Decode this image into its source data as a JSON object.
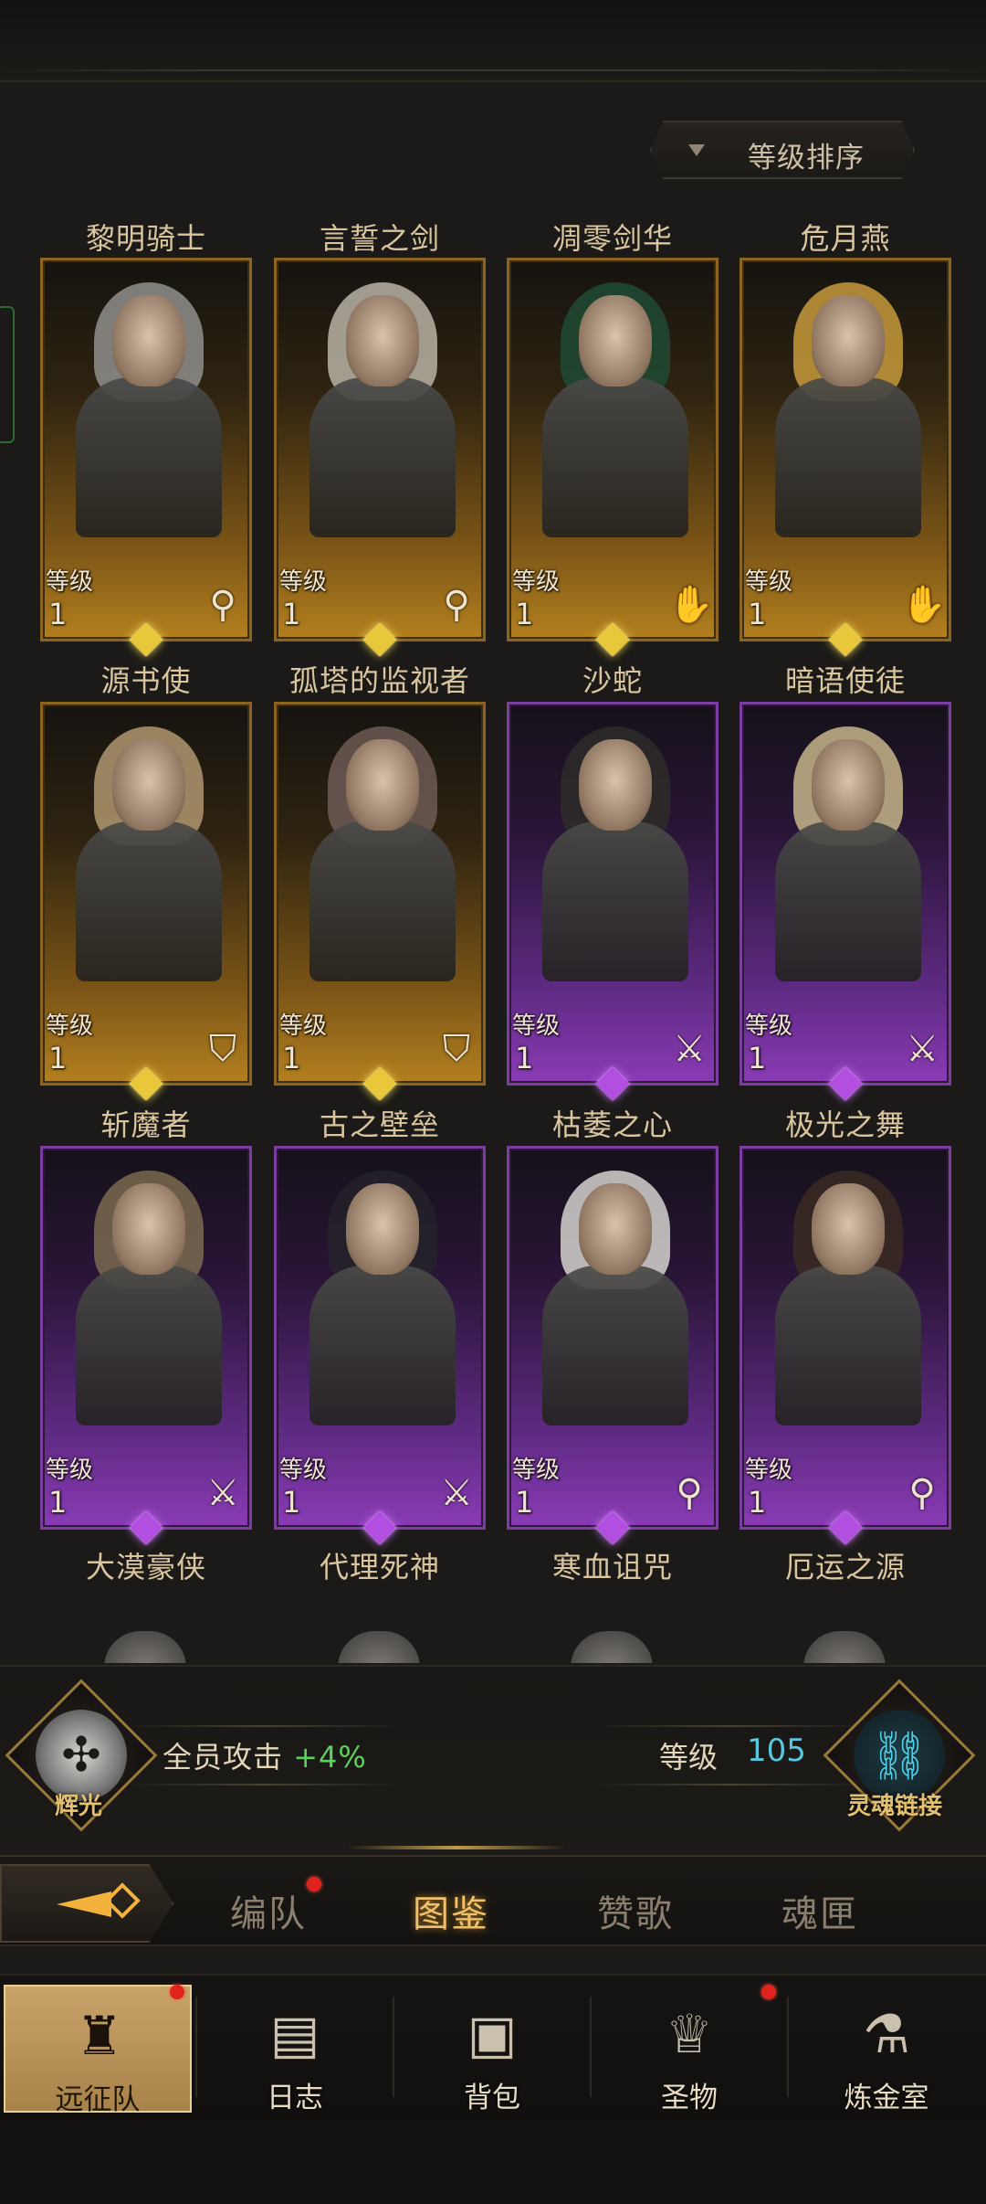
{
  "sort": {
    "label": "等级排序"
  },
  "level_label": "等级",
  "heroes": [
    {
      "name": "黎明骑士",
      "level": "1",
      "rarity": "gold",
      "class_icon": "staff-icon",
      "hair": "#8f8f8c"
    },
    {
      "name": "言誓之剑",
      "level": "1",
      "rarity": "gold",
      "class_icon": "staff-icon",
      "hair": "#b8b3a6"
    },
    {
      "name": "凋零剑华",
      "level": "1",
      "rarity": "gold",
      "class_icon": "palm-icon",
      "hair": "#1f4a32"
    },
    {
      "name": "危月燕",
      "level": "1",
      "rarity": "gold",
      "class_icon": "palm-icon",
      "hair": "#c79a3c"
    },
    {
      "name": "源书使",
      "level": "1",
      "rarity": "gold",
      "class_icon": "shield-icon",
      "hair": "#b09770"
    },
    {
      "name": "孤塔的监视者",
      "level": "1",
      "rarity": "gold",
      "class_icon": "shield-icon",
      "hair": "#6d5a55"
    },
    {
      "name": "沙蛇",
      "level": "1",
      "rarity": "purple",
      "class_icon": "sword-icon",
      "hair": "#2e2b29"
    },
    {
      "name": "暗语使徒",
      "level": "1",
      "rarity": "purple",
      "class_icon": "sword-icon",
      "hair": "#c7b58a"
    },
    {
      "name": "斩魔者",
      "level": "1",
      "rarity": "purple",
      "class_icon": "sword-icon",
      "hair": "#7a6a4f"
    },
    {
      "name": "古之壁垒",
      "level": "1",
      "rarity": "purple",
      "class_icon": "sword-icon",
      "hair": "#24222a"
    },
    {
      "name": "枯萎之心",
      "level": "1",
      "rarity": "purple",
      "class_icon": "staff-icon",
      "hair": "#d6d2cf"
    },
    {
      "name": "极光之舞",
      "level": "1",
      "rarity": "purple",
      "class_icon": "staff-icon",
      "hair": "#3a2a22"
    }
  ],
  "next_row_names": [
    "大漠豪侠",
    "代理死神",
    "寒血诅咒",
    "厄运之源"
  ],
  "bonus": {
    "left_emblem_label": "辉光",
    "attack_text": "全员攻击",
    "attack_value": "+4%",
    "level_label": "等级",
    "level_value": "105",
    "right_emblem_label": "灵魂链接"
  },
  "tabs": [
    {
      "label": "编队",
      "active": false,
      "dot": true
    },
    {
      "label": "图鉴",
      "active": true,
      "dot": false
    },
    {
      "label": "赞歌",
      "active": false,
      "dot": false
    },
    {
      "label": "魂匣",
      "active": false,
      "dot": false
    }
  ],
  "nav": [
    {
      "label": "远征队",
      "icon": "helmet-icon",
      "active": true,
      "dot": true
    },
    {
      "label": "日志",
      "icon": "scroll-icon",
      "active": false,
      "dot": false
    },
    {
      "label": "背包",
      "icon": "bag-icon",
      "active": false,
      "dot": false
    },
    {
      "label": "圣物",
      "icon": "chalice-icon",
      "active": false,
      "dot": true
    },
    {
      "label": "炼金室",
      "icon": "alchemy-icon",
      "active": false,
      "dot": false
    }
  ],
  "colors": {
    "gold_rarity": "#b3801f",
    "purple_rarity": "#8a3bb5",
    "accent_gold": "#f0c06a",
    "bonus_green": "#5ecf5e",
    "level_cyan": "#56c7dc",
    "alert_red": "#e0241d"
  }
}
